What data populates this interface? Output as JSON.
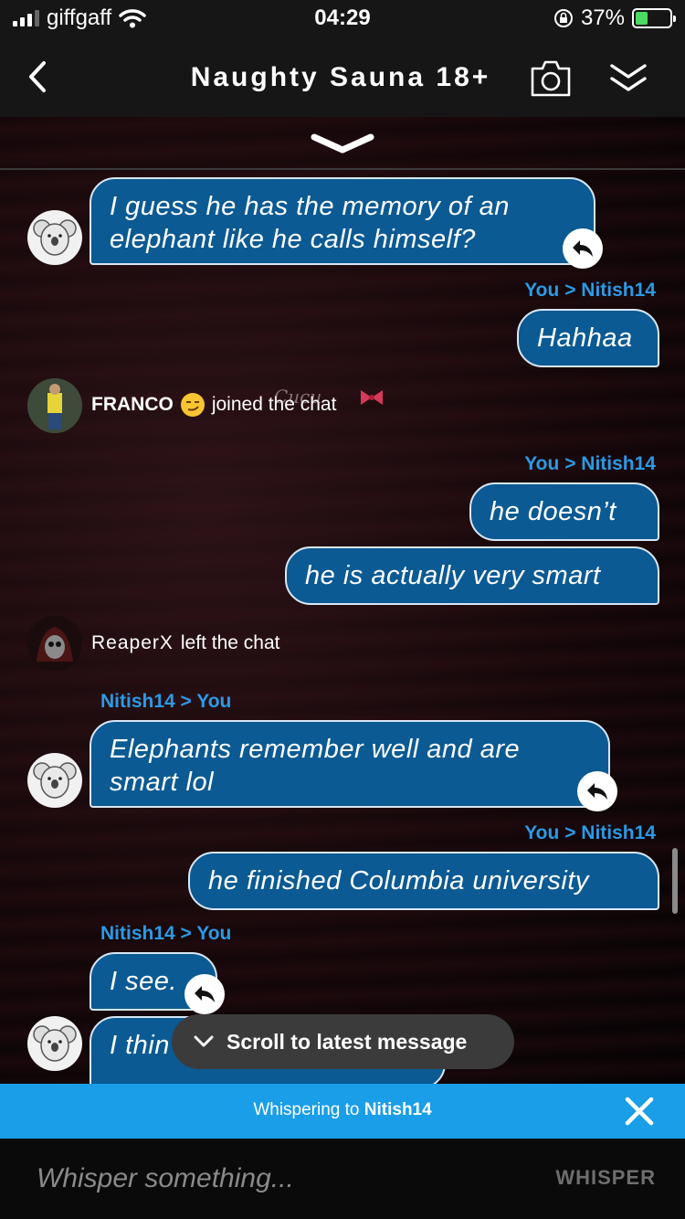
{
  "status": {
    "carrier": "giffgaff",
    "time": "04:29",
    "battery": "37%"
  },
  "header": {
    "title": "Naughty Sauna 18+"
  },
  "messages": {
    "m1": {
      "text": "I guess he has the memory of an elephant like he calls himself?"
    },
    "w1": {
      "from": "You",
      "to": "Nitish14"
    },
    "m2": {
      "text": "Hahhaa"
    },
    "s1": {
      "name": "FRANCO",
      "action": "joined the chat",
      "overlay": "Cucu"
    },
    "w2": {
      "from": "You",
      "to": "Nitish14"
    },
    "m3": {
      "text": "he doesn’t"
    },
    "m4": {
      "text": "he is actually very smart"
    },
    "s2": {
      "name": "ReaperX",
      "action": "left the chat"
    },
    "w3": {
      "from": "Nitish14",
      "to": "You"
    },
    "m5": {
      "text": "Elephants remember well and are smart lol"
    },
    "w4": {
      "from": "You",
      "to": "Nitish14"
    },
    "m6": {
      "text": "he finished Columbia university"
    },
    "w5": {
      "from": "Nitish14",
      "to": "You"
    },
    "m7": {
      "text": "I see."
    },
    "m8": {
      "text": "I thin"
    }
  },
  "separator": ">",
  "scroll_pill": {
    "label": "Scroll to latest message"
  },
  "whisper_bar": {
    "prefix": "Whispering to",
    "target": "Nitish14"
  },
  "input": {
    "placeholder": "Whisper something...",
    "send_label": "WHISPER"
  },
  "colors": {
    "bubble": "#0b5a93",
    "label": "#2b9ae6",
    "banner": "#1a9ee8"
  }
}
